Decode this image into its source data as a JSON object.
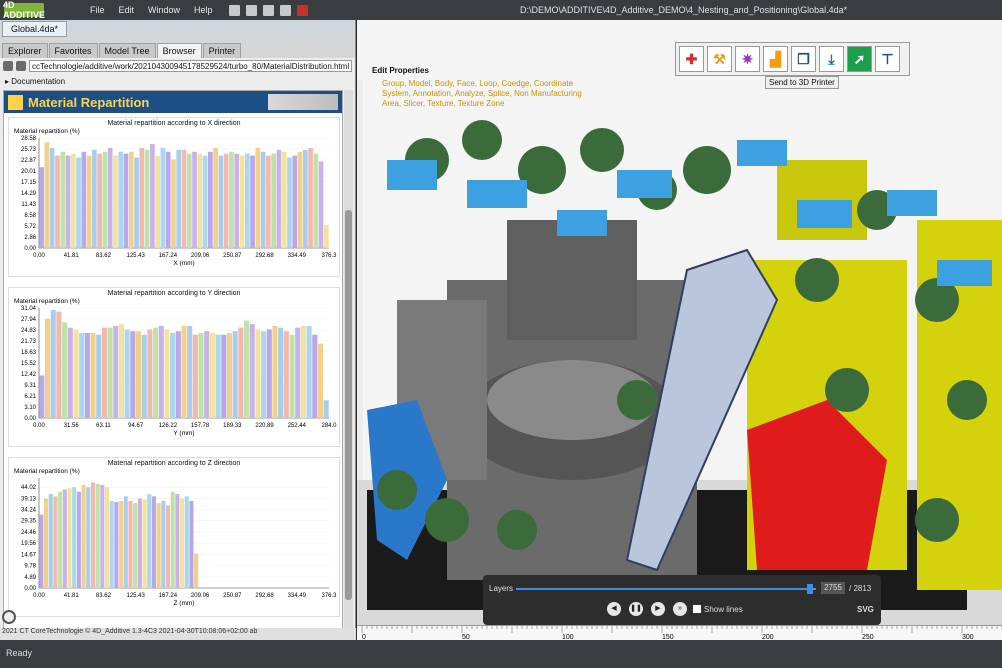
{
  "app": {
    "logo_text": "4D ADDITIVE",
    "menu": [
      "File",
      "Edit",
      "Window",
      "Help"
    ],
    "title_path": "D:\\DEMO\\ADDITIVE\\4D_Additive_DEMO\\4_Nesting_and_Positioning\\Global.4da*"
  },
  "left_panel": {
    "doc_tab": "Global.4da*",
    "tabs": [
      "Explorer",
      "Favorites",
      "Model Tree",
      "Browser",
      "Printer"
    ],
    "active_tab": "Browser",
    "url": "ccTechnologie/additive/work/202104300945178529524/turbo_80/MaterialDistribution.html",
    "section": "Documentation",
    "report_title": "Material Repartition",
    "footer": "2021 CT CoreTechnologie © 4D_Additive 1.3-4C3 2021-04-30T10:08:06+02:00 ab"
  },
  "chart_data": [
    {
      "type": "bar",
      "title": "Material repartition according to X direction",
      "ylabel": "Material repartition (%)",
      "xlabel": "X (mm)",
      "yticks": [
        0.0,
        2.86,
        5.72,
        8.58,
        11.43,
        14.29,
        17.15,
        20.01,
        22.87,
        25.73,
        28.58
      ],
      "xticks": [
        "0.00",
        "41.81",
        "83.62",
        "125.43",
        "167.24",
        "209.06",
        "250.87",
        "292.68",
        "334.49",
        "376.3"
      ],
      "ylim": [
        0,
        28.58
      ],
      "values": [
        21,
        27.5,
        26,
        24,
        25,
        24,
        24.5,
        23.5,
        25,
        24,
        25.5,
        24.5,
        25,
        26,
        24,
        25,
        24.5,
        25,
        23.5,
        26,
        25.5,
        27,
        24,
        26,
        25,
        23,
        25.5,
        25.5,
        24.5,
        25,
        24.5,
        24,
        25,
        26,
        24,
        24.5,
        25,
        24.5,
        24,
        24.5,
        24,
        26,
        25,
        24,
        24.5,
        25.5,
        25,
        23.5,
        24,
        25,
        25.5,
        26,
        24.5,
        22.5,
        6
      ]
    },
    {
      "type": "bar",
      "title": "Material repartition according to Y direction",
      "ylabel": "Material repartition (%)",
      "xlabel": "Y (mm)",
      "yticks": [
        0.0,
        3.1,
        6.21,
        9.31,
        12.42,
        15.52,
        18.63,
        21.73,
        24.83,
        27.94,
        31.04
      ],
      "xticks": [
        "0.00",
        "31.56",
        "63.11",
        "94.67",
        "126.22",
        "157.78",
        "189.33",
        "220.89",
        "252.44",
        "284.0"
      ],
      "ylim": [
        0,
        31.04
      ],
      "values": [
        12,
        28,
        30.5,
        30,
        27,
        25.5,
        25,
        24,
        24,
        24,
        23.5,
        25.5,
        25.5,
        26,
        26.5,
        25,
        24.5,
        24.5,
        23.5,
        25,
        25.5,
        26,
        25,
        24,
        24.5,
        26,
        26,
        23.5,
        24,
        24.5,
        24,
        23.5,
        23.5,
        24,
        24.5,
        25.5,
        27.5,
        26.5,
        25,
        24.5,
        25,
        26,
        25.5,
        24.5,
        23.5,
        25.5,
        26,
        26,
        23.5,
        21,
        5
      ]
    },
    {
      "type": "bar",
      "title": "Material repartition according to Z direction",
      "ylabel": "Material repartition (%)",
      "xlabel": "Z (mm)",
      "yticks": [
        0.0,
        4.89,
        9.78,
        14.67,
        19.56,
        24.46,
        29.35,
        34.24,
        39.13,
        44.02
      ],
      "xticks": [
        "0.00",
        "41.81",
        "83.62",
        "125.43",
        "167.24",
        "209.06",
        "250.87",
        "292.68",
        "334.49",
        "376.3"
      ],
      "ylim": [
        0,
        48
      ],
      "values": [
        32,
        39,
        41,
        40,
        42,
        43,
        43.5,
        44,
        42,
        45,
        44,
        46,
        45.5,
        45,
        44,
        38,
        37.5,
        38,
        40,
        38,
        37,
        39,
        38.5,
        41,
        40,
        37,
        38,
        36,
        42,
        41,
        39,
        40,
        38,
        15
      ]
    }
  ],
  "viewport": {
    "edit_props_title": "Edit Properties",
    "edit_props_links": "Group, Model, Body, Face, Loop, Coedge, Coordinate System, Annotation, Analyze, Splice, Non Manufacturing Area, Slicer, Texture, Texture Zone",
    "send_label": "Send to 3D Printer",
    "layers_label": "Layers",
    "layer_value": "2755",
    "layer_total": "/ 2813",
    "layer_fraction": 0.98,
    "show_lines_label": "Show lines",
    "svg_label": "SVG",
    "ruler_ticks": [
      "0",
      "50",
      "100",
      "150",
      "200",
      "250",
      "300"
    ]
  },
  "status": "Ready",
  "colors": {
    "accent": "#1b4f86",
    "brand": "#7fb33a",
    "slider": "#3a8ee6"
  }
}
